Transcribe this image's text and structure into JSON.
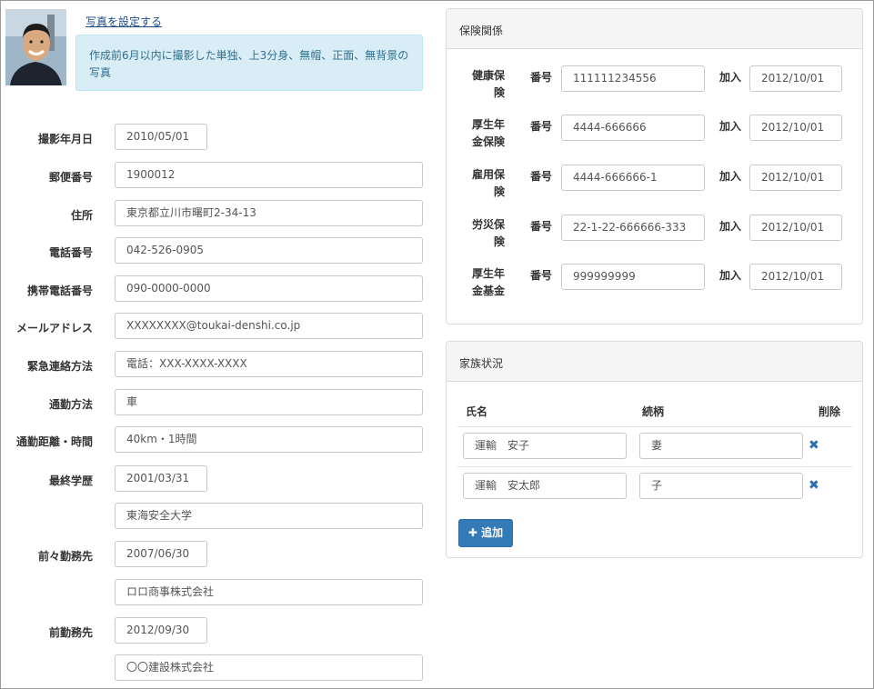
{
  "photo": {
    "link": "写真を設定する",
    "note": "作成前6月以内に撮影した単独、上3分身、無帽、正面、無背景の写真"
  },
  "personal": [
    {
      "label": "撮影年月日",
      "value": "2010/05/01",
      "size": "short"
    },
    {
      "label": "郵便番号",
      "value": "1900012",
      "size": "long"
    },
    {
      "label": "住所",
      "value": "東京都立川市曙町2-34-13",
      "size": "long"
    },
    {
      "label": "電話番号",
      "value": "042-526-0905",
      "size": "long"
    },
    {
      "label": "携帯電話番号",
      "value": "090-0000-0000",
      "size": "long"
    },
    {
      "label": "メールアドレス",
      "value": "XXXXXXXX@toukai-denshi.co.jp",
      "size": "long"
    },
    {
      "label": "緊急連絡方法",
      "value": "電話：XXX-XXXX-XXXX",
      "size": "long"
    },
    {
      "label": "通勤方法",
      "value": "車",
      "size": "long"
    },
    {
      "label": "通勤距離・時間",
      "value": "40km・1時間",
      "size": "long"
    },
    {
      "label": "最終学歴",
      "value": "2001/03/31",
      "size": "short"
    },
    {
      "label": "",
      "value": "東海安全大学",
      "size": "long"
    },
    {
      "label": "前々勤務先",
      "value": "2007/06/30",
      "size": "short"
    },
    {
      "label": "",
      "value": "ロロ商事株式会社",
      "size": "long"
    },
    {
      "label": "前勤務先",
      "value": "2012/09/30",
      "size": "short"
    },
    {
      "label": "",
      "value": "〇〇建設株式会社",
      "size": "long"
    }
  ],
  "insurance": {
    "title": "保険関係",
    "number_label": "番号",
    "join_label": "加入",
    "rows": [
      {
        "name_line1": "健康保",
        "name_line2": "険",
        "number": "111111234556",
        "joined": "2012/10/01"
      },
      {
        "name_line1": "厚生年",
        "name_line2": "金保険",
        "number": "4444-666666",
        "joined": "2012/10/01"
      },
      {
        "name_line1": "雇用保",
        "name_line2": "険",
        "number": "4444-666666-1",
        "joined": "2012/10/01"
      },
      {
        "name_line1": "労災保",
        "name_line2": "険",
        "number": "22-1-22-666666-333",
        "joined": "2012/10/01"
      },
      {
        "name_line1": "厚生年",
        "name_line2": "金基金",
        "number": "999999999",
        "joined": "2012/10/01"
      }
    ]
  },
  "family": {
    "title": "家族状況",
    "col_name": "氏名",
    "col_relation": "続柄",
    "col_delete": "削除",
    "delete_glyph": "✖",
    "rows": [
      {
        "name": "運輸　安子",
        "relation": "妻"
      },
      {
        "name": "運輸　安太郎",
        "relation": "子"
      }
    ],
    "add_label": "追加"
  }
}
